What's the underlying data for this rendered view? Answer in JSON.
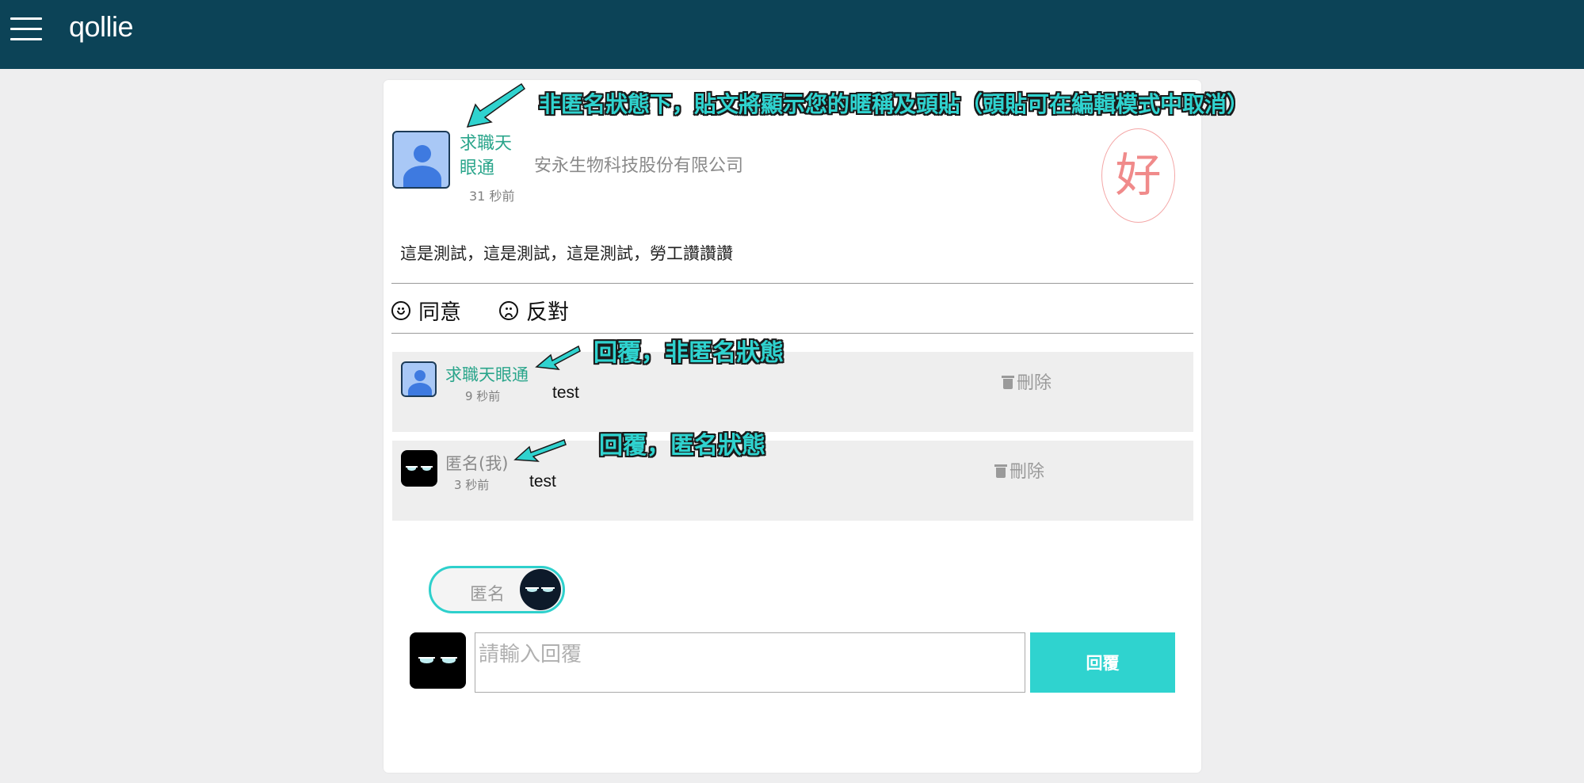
{
  "app": {
    "name": "qollie"
  },
  "post": {
    "author": "求職天眼通",
    "time": "31 秒前",
    "company": "安永生物科技股份有限公司",
    "stamp": "好",
    "content": "這是測試，這是測試，這是測試，勞工讚讚讚"
  },
  "votes": {
    "agree": "同意",
    "disagree": "反對"
  },
  "replies": [
    {
      "author": "求職天眼通",
      "time": "9 秒前",
      "text": "test",
      "delete_label": "刪除"
    },
    {
      "author": "匿名(我)",
      "time": "3 秒前",
      "text": "test",
      "delete_label": "刪除"
    }
  ],
  "composer": {
    "toggle_label": "匿名",
    "placeholder": "請輸入回覆",
    "value": "",
    "submit_label": "回覆"
  },
  "annotations": {
    "top": "非匿名狀態下，貼文將顯示您的暱稱及頭貼（頭貼可在編輯模式中取消）",
    "reply_named": "回覆，非匿名狀態",
    "reply_anon": "回覆，匿名狀態"
  },
  "colors": {
    "topbar": "#0c4357",
    "accent": "#2fd3cf",
    "author_green": "#2aa58b",
    "stamp": "#f08a8a"
  },
  "icons": [
    "menu-icon",
    "user-avatar-icon",
    "anonymous-avatar-icon",
    "smile-icon",
    "frown-icon",
    "trash-icon",
    "arrow-icon"
  ]
}
